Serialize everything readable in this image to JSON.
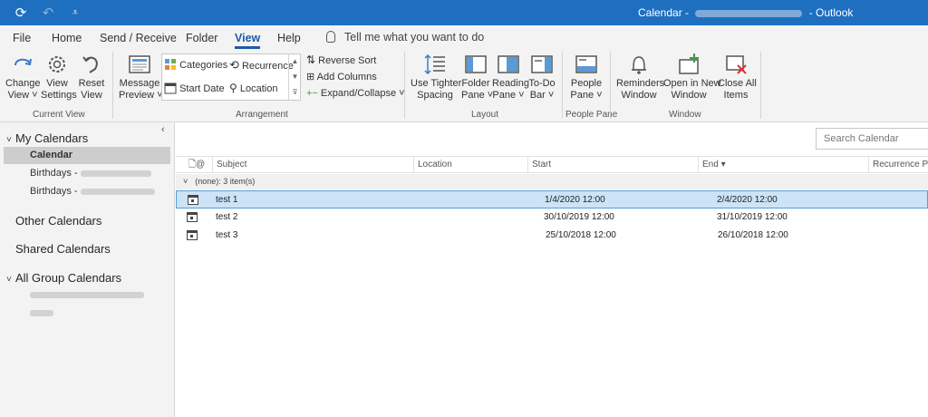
{
  "window": {
    "title_prefix": "Calendar -",
    "title_suffix": "- Outlook",
    "accent_color": "#1f6fc0"
  },
  "qat": {
    "sync_icon": "sync-icon",
    "undo_icon": "undo-icon",
    "customize_icon": "customize-qat-icon"
  },
  "menu": {
    "tabs": [
      "File",
      "Home",
      "Send / Receive",
      "Folder",
      "View",
      "Help"
    ],
    "active_tab": "View",
    "tell_me": "Tell me what you want to do"
  },
  "ribbon": {
    "current_view": {
      "group_label": "Current View",
      "change_view": [
        "Change",
        "View ˅"
      ],
      "view_settings": [
        "View",
        "Settings"
      ],
      "reset_view": [
        "Reset",
        "View"
      ]
    },
    "message_preview": [
      "Message",
      "Preview ˅"
    ],
    "arrangement": {
      "group_label": "Arrangement",
      "categories": "Categories",
      "recurrence": "Recurrence",
      "start_date": "Start Date",
      "location": "Location",
      "reverse_sort": "Reverse Sort",
      "add_columns": "Add Columns",
      "expand_collapse": "Expand/Collapse ˅"
    },
    "layout": {
      "group_label": "Layout",
      "tighter_spacing": [
        "Use Tighter",
        "Spacing"
      ],
      "folder_pane": [
        "Folder",
        "Pane ˅"
      ],
      "reading_pane": [
        "Reading",
        "Pane ˅"
      ],
      "todo_bar": [
        "To-Do",
        "Bar ˅"
      ]
    },
    "people_pane": {
      "group_label": "People Pane",
      "people_pane": [
        "People",
        "Pane ˅"
      ]
    },
    "window": {
      "group_label": "Window",
      "reminders": [
        "Reminders",
        "Window"
      ],
      "open_new": [
        "Open in New",
        "Window"
      ],
      "close_all": [
        "Close All",
        "Items"
      ]
    }
  },
  "sidebar": {
    "my_calendars": "My Calendars",
    "calendar": "Calendar",
    "birthdays_1": "Birthdays -",
    "birthdays_2": "Birthdays -",
    "other_calendars": "Other Calendars",
    "shared_calendars": "Shared Calendars",
    "all_group_calendars": "All Group Calendars"
  },
  "list": {
    "search_placeholder": "Search Calendar",
    "columns": {
      "subject": "Subject",
      "location": "Location",
      "start": "Start",
      "end": "End ▾",
      "recurrence": "Recurrence Patte"
    },
    "group": "(none): 3 item(s)",
    "rows": [
      {
        "subject": "test 1",
        "start": "1/4/2020 12:00",
        "end": "2/4/2020 12:00"
      },
      {
        "subject": "test 2",
        "start": "30/10/2019 12:00",
        "end": "31/10/2019 12:00"
      },
      {
        "subject": "test 3",
        "start": "25/10/2018 12:00",
        "end": "26/10/2018 12:00"
      }
    ]
  }
}
